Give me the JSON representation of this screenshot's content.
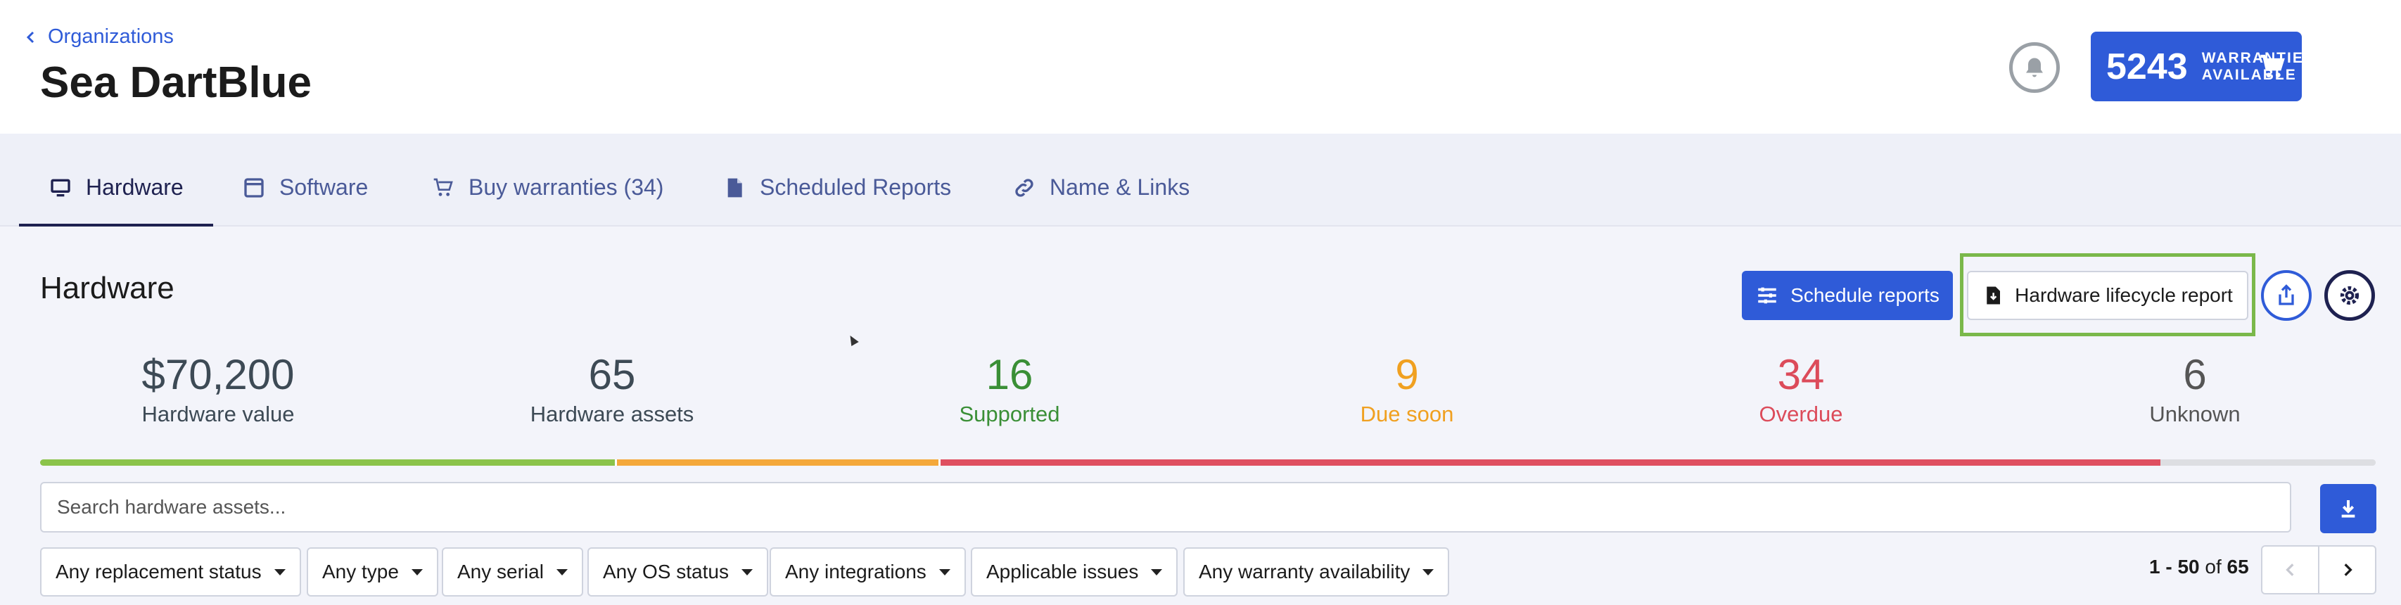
{
  "header": {
    "breadcrumb": "Organizations",
    "title": "Sea DartBlue",
    "warranties": {
      "count": "5243",
      "label": "WARRANTIES AVAILABLE"
    }
  },
  "tabs": [
    {
      "label": "Hardware",
      "icon": "monitor-icon",
      "active": true
    },
    {
      "label": "Software",
      "icon": "window-icon"
    },
    {
      "label": "Buy warranties (34)",
      "icon": "cart-icon"
    },
    {
      "label": "Scheduled Reports",
      "icon": "document-icon"
    },
    {
      "label": "Name & Links",
      "icon": "link-icon"
    }
  ],
  "section": {
    "title": "Hardware",
    "schedule_label": "Schedule reports",
    "lifecycle_label": "Hardware lifecycle report"
  },
  "stats": [
    {
      "value": "$70,200",
      "label": "Hardware value",
      "color": "#3d4a55"
    },
    {
      "value": "65",
      "label": "Hardware assets",
      "color": "#3d4a55"
    },
    {
      "value": "16",
      "label": "Supported",
      "color": "#3a8f36"
    },
    {
      "value": "9",
      "label": "Due soon",
      "color": "#f0a020"
    },
    {
      "value": "34",
      "label": "Overdue",
      "color": "#dc4b5a"
    },
    {
      "value": "6",
      "label": "Unknown",
      "color": "#555555"
    }
  ],
  "progress": [
    {
      "name": "Supported",
      "fraction": 0.2462,
      "color": "#8bc34a"
    },
    {
      "name": "Due soon",
      "fraction": 0.1385,
      "color": "#f4a83a"
    },
    {
      "name": "Overdue",
      "fraction": 0.5231,
      "color": "#df4f60"
    },
    {
      "name": "Unknown",
      "fraction": 0.0923,
      "color": "#dddee2"
    }
  ],
  "search": {
    "placeholder": "Search hardware assets..."
  },
  "filters": [
    "Any replacement status",
    "Any type",
    "Any serial",
    "Any OS status",
    "Any integrations",
    "Applicable issues",
    "Any warranty availability"
  ],
  "pagination": {
    "range": "1 - 50",
    "of": "of",
    "total": "65"
  },
  "colors": {
    "accent": "#2f5bd8",
    "navy": "#1e2150",
    "highlight": "#7ab84a"
  }
}
